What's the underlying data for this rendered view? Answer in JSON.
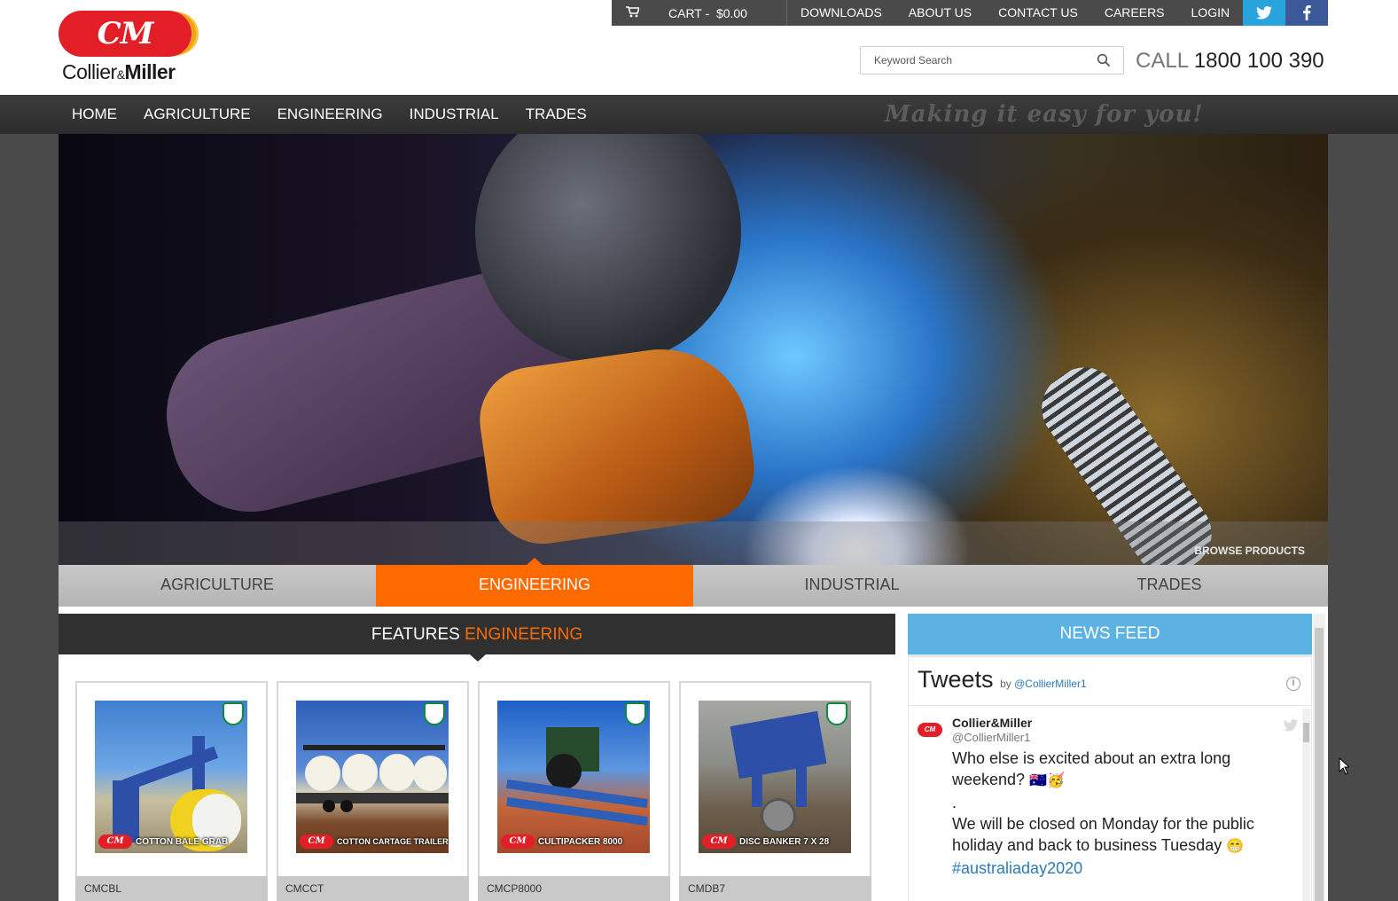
{
  "brand": {
    "badge": "CM",
    "name_regular": "Collier",
    "name_amp": "&",
    "name_bold": "Miller"
  },
  "topbar": {
    "cart_icon": "cart-icon",
    "cart_label": "CART -",
    "cart_total": "$0.00",
    "links": [
      "DOWNLOADS",
      "ABOUT US",
      "CONTACT US",
      "CAREERS",
      "LOGIN"
    ],
    "social": {
      "twitter": "twitter-icon",
      "facebook": "facebook-icon"
    }
  },
  "search": {
    "placeholder": "Keyword Search",
    "icon": "search-icon"
  },
  "phone": {
    "prefix": "CALL",
    "number": "1800 100 390"
  },
  "nav": {
    "items": [
      "HOME",
      "AGRICULTURE",
      "ENGINEERING",
      "INDUSTRIAL",
      "TRADES"
    ],
    "tagline": "Making it easy for you!"
  },
  "hero": {
    "browse_label": "BROWSE PRODUCTS"
  },
  "category_tabs": {
    "items": [
      "AGRICULTURE",
      "ENGINEERING",
      "INDUSTRIAL",
      "TRADES"
    ],
    "active": "ENGINEERING"
  },
  "features": {
    "title_prefix": "FEATURES",
    "title_accent": "ENGINEERING",
    "products": [
      {
        "caption": "COTTON BALE GRAB",
        "code": "CMCBL"
      },
      {
        "caption": "COTTON CARTAGE TRAILER",
        "code": "CMCCT"
      },
      {
        "caption": "CULTIPACKER 8000",
        "code": "CMCP8000"
      },
      {
        "caption": "DISC BANKER 7 X 28",
        "code": "CMDB7"
      }
    ]
  },
  "news": {
    "header": "NEWS FEED",
    "tweets_title": "Tweets",
    "tweets_by": "by",
    "tweets_handle": "@CollierMiller1",
    "tweet": {
      "name": "Collier&Miller",
      "handle": "@CollierMiller1",
      "line1": "Who else is excited about an extra long weekend?",
      "line1_emoji": "🇦🇺🥳",
      "line2": ".",
      "line3": "We will be closed on Monday for the public holiday and back to business Tuesday",
      "line3_emoji": "😁",
      "hashtag": "#australiaday2020"
    }
  },
  "colors": {
    "brand_red": "#e21e26",
    "accent_orange": "#ff6a00",
    "news_blue": "#5cb2e2",
    "twitter_blue": "#29a3dc",
    "facebook_blue": "#3b5998"
  }
}
